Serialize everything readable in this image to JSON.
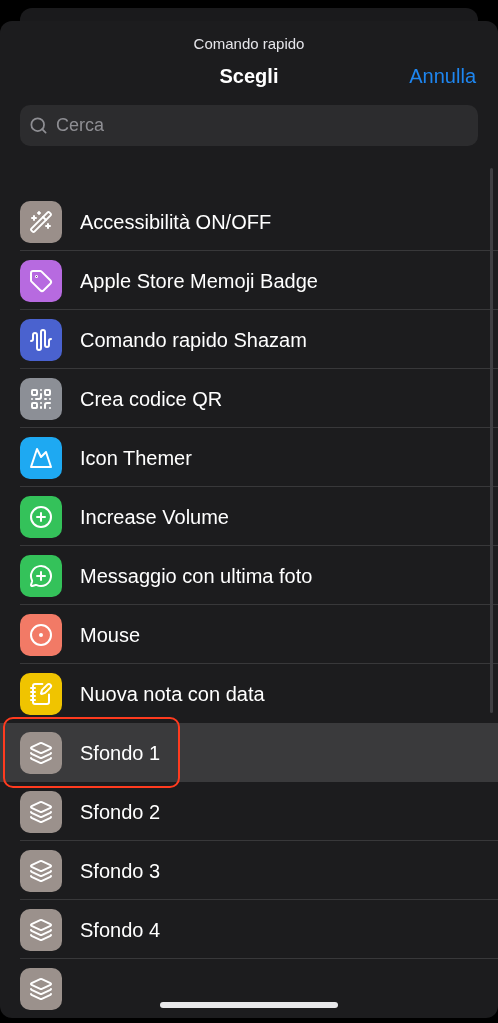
{
  "sheet": {
    "caption": "Comando rapido",
    "title": "Scegli",
    "cancel": "Annulla"
  },
  "search": {
    "placeholder": "Cerca"
  },
  "items": [
    {
      "label": "Accessibilità ON/OFF",
      "kind": "wand",
      "color": "#9a8f8a",
      "selected": false,
      "outlined": false
    },
    {
      "label": "Apple Store Memoji Badge",
      "kind": "tag",
      "color": "#b76ae0",
      "selected": false,
      "outlined": false
    },
    {
      "label": "Comando rapido Shazam",
      "kind": "wave",
      "color": "#4a62cf",
      "selected": false,
      "outlined": false
    },
    {
      "label": "Crea codice QR",
      "kind": "qr",
      "color": "#8c8f96",
      "selected": false,
      "outlined": false
    },
    {
      "label": "Icon Themer",
      "kind": "mountain",
      "color": "#1ea9f2",
      "selected": false,
      "outlined": false
    },
    {
      "label": "Increase Volume",
      "kind": "plus",
      "color": "#34c25a",
      "selected": false,
      "outlined": false
    },
    {
      "label": "Messaggio con ultima foto",
      "kind": "message",
      "color": "#34c25a",
      "selected": false,
      "outlined": false
    },
    {
      "label": "Mouse",
      "kind": "target",
      "color": "#f27a66",
      "selected": false,
      "outlined": false
    },
    {
      "label": "Nuova nota con data",
      "kind": "note",
      "color": "#f0c400",
      "selected": false,
      "outlined": false
    },
    {
      "label": "Sfondo 1",
      "kind": "layers",
      "color": "#9b918c",
      "selected": true,
      "outlined": true
    },
    {
      "label": "Sfondo 2",
      "kind": "layers",
      "color": "#9b918c",
      "selected": false,
      "outlined": false
    },
    {
      "label": "Sfondo 3",
      "kind": "layers",
      "color": "#9b918c",
      "selected": false,
      "outlined": false
    },
    {
      "label": "Sfondo 4",
      "kind": "layers",
      "color": "#9b918c",
      "selected": false,
      "outlined": false
    },
    {
      "kind": "layers",
      "color": "#9b918c",
      "selected": false,
      "outlined": false
    }
  ]
}
